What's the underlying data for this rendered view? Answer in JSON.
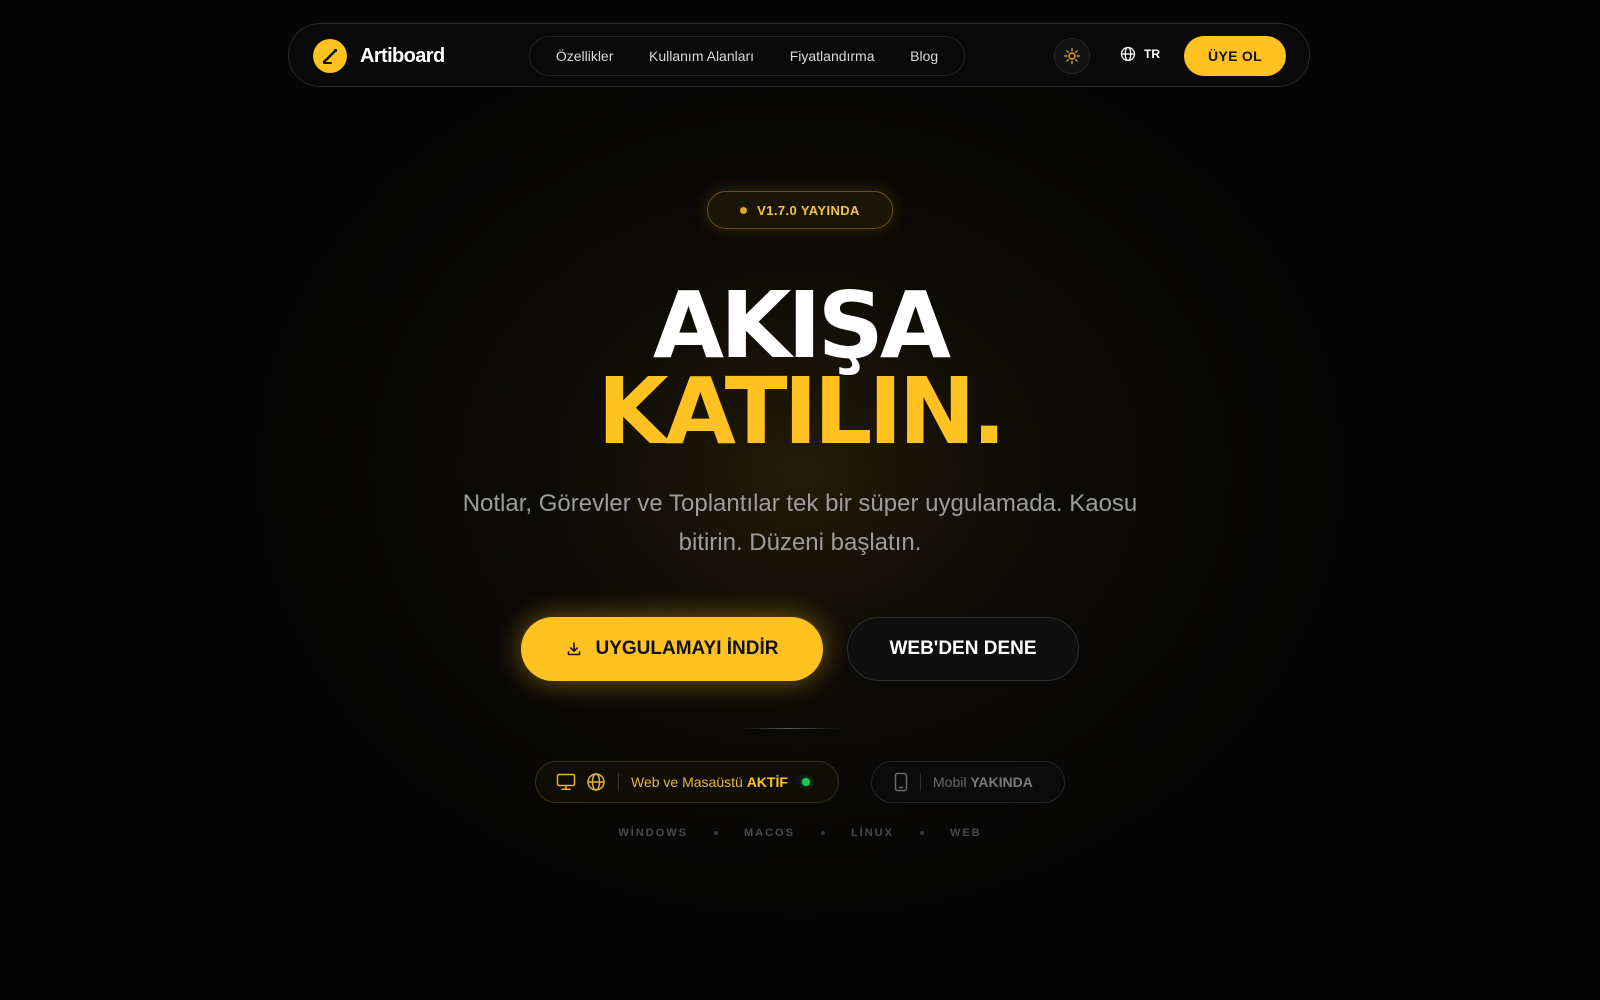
{
  "brand": {
    "name": "Artiboard",
    "logo_icon": "pen-icon",
    "accent": "#ffc220"
  },
  "nav": {
    "links": [
      "Özellikler",
      "Kullanım Alanları",
      "Fiyatlandırma",
      "Blog"
    ],
    "theme_icon": "sun-icon",
    "lang_icon": "globe-icon",
    "lang": "TR",
    "signup": "ÜYE OL"
  },
  "hero": {
    "badge": "V1.7.0 YAYINDA",
    "title_line1": "AKIŞA",
    "title_line2": "KATILIN.",
    "subtitle": "Notlar, Görevler ve Toplantılar tek bir süper uygulamada. Kaosu bitirin. Düzeni başlatın.",
    "cta_primary": "UYGULAMAYI İNDİR",
    "cta_primary_icon": "download-icon",
    "cta_secondary": "WEB'DEN DENE"
  },
  "status": {
    "active_label": "Web ve Masaüstü",
    "active_state": "AKTİF",
    "active_icons": [
      "monitor-icon",
      "globe-icon"
    ],
    "soon_label": "Mobil",
    "soon_state": "YAKINDA",
    "soon_icon": "phone-icon",
    "active_color": "#22c55e"
  },
  "platforms": [
    "WİNDOWS",
    "MACOS",
    "LİNUX",
    "WEB"
  ]
}
